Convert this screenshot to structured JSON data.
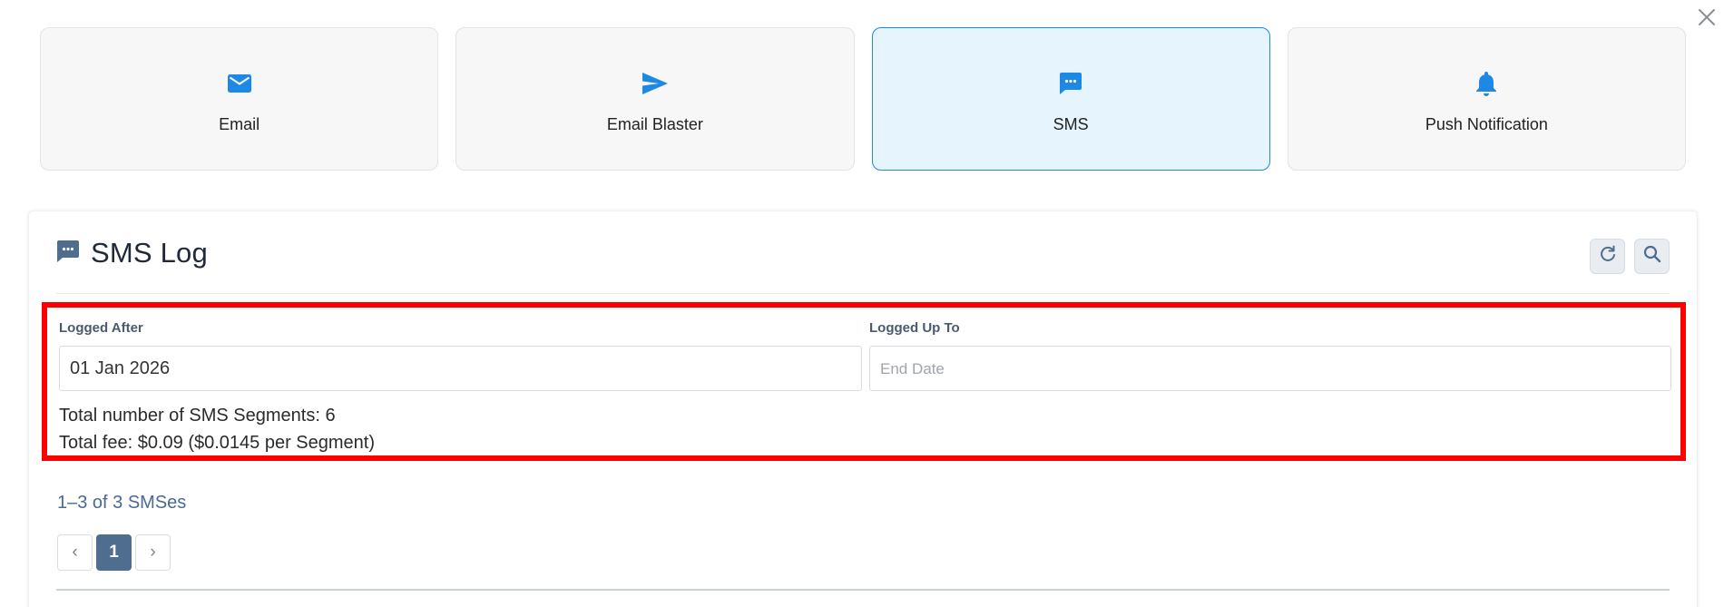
{
  "channels": [
    {
      "label": "Email",
      "icon": "mail-icon",
      "selected": false
    },
    {
      "label": "Email Blaster",
      "icon": "send-icon",
      "selected": false
    },
    {
      "label": "SMS",
      "icon": "chat-icon",
      "selected": true
    },
    {
      "label": "Push Notification",
      "icon": "bell-icon",
      "selected": false
    }
  ],
  "log": {
    "title": "SMS Log",
    "refresh_icon": "refresh-icon",
    "search_icon": "search-icon"
  },
  "filters": {
    "logged_after_label": "Logged After",
    "logged_after_value": "01 Jan 2026",
    "logged_up_to_label": "Logged Up To",
    "logged_up_to_placeholder": "End Date"
  },
  "totals": {
    "segments_text": "Total number of SMS Segments: 6",
    "fee_text": "Total fee: $0.09 ($0.0145 per Segment)"
  },
  "pagination": {
    "count_text": "1–3 of 3 SMSes",
    "current_page": "1",
    "prev": "‹",
    "next": "›"
  },
  "colors": {
    "accent": "#1e88e5",
    "selected_card_bg": "#e6f4fd",
    "highlight": "#ff0000",
    "active_page": "#4e6d8f"
  }
}
